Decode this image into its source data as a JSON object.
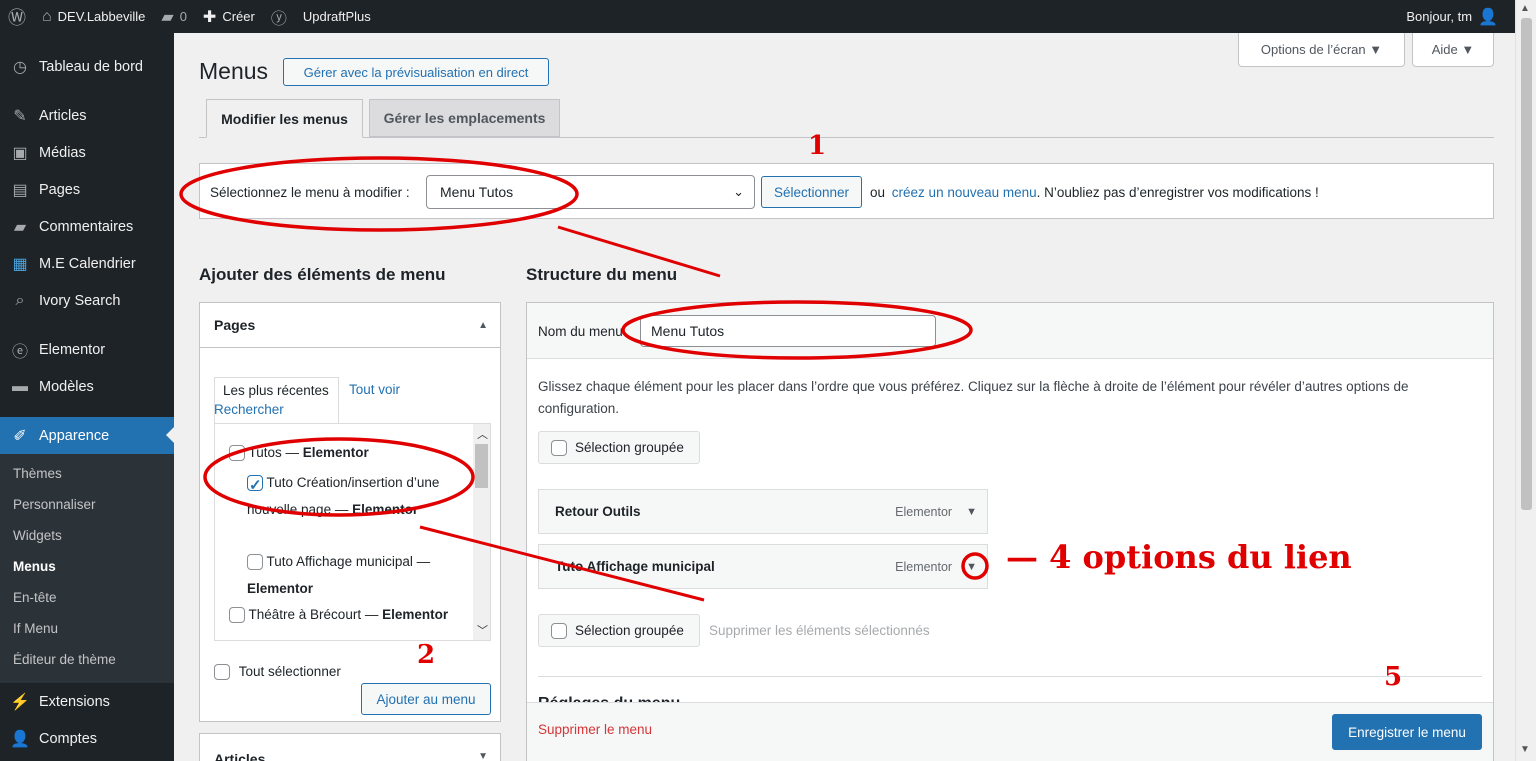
{
  "adminbar": {
    "site_name": "DEV.Labbeville",
    "comments_count": "0",
    "new_label": "Créer",
    "plugin_label": "UpdraftPlus",
    "greeting": "Bonjour, tm"
  },
  "sidebar": {
    "items_top": [
      {
        "label": "Tableau de bord",
        "icon": "dashboard-icon"
      },
      {
        "label": "Articles",
        "icon": "pin-icon"
      },
      {
        "label": "Médias",
        "icon": "media-icon"
      },
      {
        "label": "Pages",
        "icon": "pages-icon"
      },
      {
        "label": "Commentaires",
        "icon": "comments-icon"
      },
      {
        "label": "M.E Calendrier",
        "icon": "calendar-icon"
      },
      {
        "label": "Ivory Search",
        "icon": "search-icon"
      },
      {
        "label": "Elementor",
        "icon": "elementor-icon"
      },
      {
        "label": "Modèles",
        "icon": "folder-icon"
      }
    ],
    "current": {
      "label": "Apparence",
      "icon": "brush-icon"
    },
    "submenu": [
      "Thèmes",
      "Personnaliser",
      "Widgets",
      "Menus",
      "En-tête",
      "If Menu",
      "Éditeur de thème"
    ],
    "items_bottom": [
      {
        "label": "Extensions",
        "icon": "plugin-icon"
      },
      {
        "label": "Comptes",
        "icon": "user-icon"
      }
    ]
  },
  "header": {
    "title": "Menus",
    "live_preview_button": "Gérer avec la prévisualisation en direct",
    "screen_options": "Options de l’écran ▼",
    "help": "Aide ▼"
  },
  "tabs": {
    "edit": "Modifier les menus",
    "locations": "Gérer les emplacements"
  },
  "select_bar": {
    "label": "Sélectionnez le menu à modifier :",
    "selected": "Menu Tutos",
    "select_button": "Sélectionner",
    "or_text": "ou",
    "create_link": "créez un nouveau menu",
    "note": ". N’oubliez pas d’enregistrer vos modifications !"
  },
  "add_items": {
    "heading": "Ajouter des éléments de menu",
    "pages_title": "Pages",
    "tab_recent": "Les plus récentes",
    "tab_all": "Tout voir",
    "tab_search": "Rechercher",
    "list": [
      {
        "prefix": "Tutos — ",
        "bold": "Elementor",
        "checked": false
      },
      {
        "prefix": "Tuto Création/insertion d’une nouvelle page — ",
        "bold": "Elementor",
        "checked": true
      },
      {
        "prefix": "Tuto Affichage municipal — ",
        "bold": "Elementor",
        "checked": false
      },
      {
        "prefix": "Théâtre à Brécourt — ",
        "bold": "Elementor",
        "checked": false
      }
    ],
    "select_all": "Tout sélectionner",
    "add_button": "Ajouter au menu",
    "articles_title": "Articles"
  },
  "structure": {
    "heading": "Structure du menu",
    "name_label": "Nom du menu",
    "name_value": "Menu Tutos",
    "instructions": "Glissez chaque élément pour les placer dans l’ordre que vous préférez. Cliquez sur la flèche à droite de l’élément pour révéler d’autres options de configuration.",
    "bulk_select": "Sélection groupée",
    "items": [
      {
        "title": "Retour Outils",
        "type": "Elementor"
      },
      {
        "title": "Tuto Affichage municipal",
        "type": "Elementor"
      }
    ],
    "delete_selected": "Supprimer les éléments sélectionnés",
    "settings_heading": "Réglages du menu",
    "delete_menu": "Supprimer le menu",
    "save_button": "Enregistrer le menu"
  },
  "annotations": {
    "n1": "1",
    "n2": "2",
    "n5": "5",
    "options_text": "— 4 options du lien",
    "color": "#e00000"
  }
}
